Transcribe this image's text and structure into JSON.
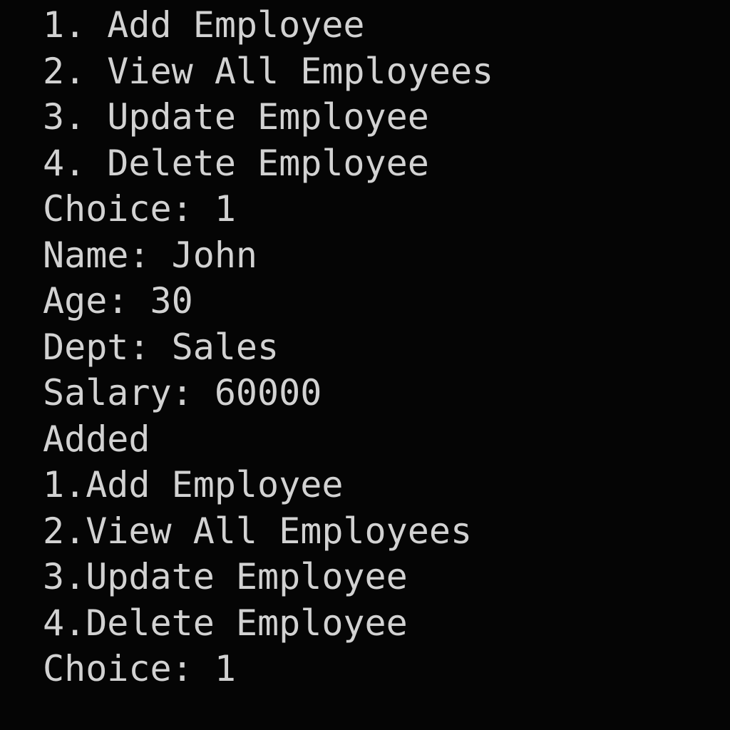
{
  "terminal": {
    "lines": [
      "1. Add Employee",
      "2. View All Employees",
      "3. Update Employee",
      "4. Delete Employee",
      "Choice: 1",
      "Name: John",
      "Age: 30",
      "Dept: Sales",
      "Salary: 60000",
      "Added",
      "1.Add Employee",
      "2.View All Employees",
      "3.Update Employee",
      "4.Delete Employee",
      "Choice: 1"
    ],
    "colors": {
      "background": "#050505",
      "text": "#d2d2d2"
    }
  }
}
